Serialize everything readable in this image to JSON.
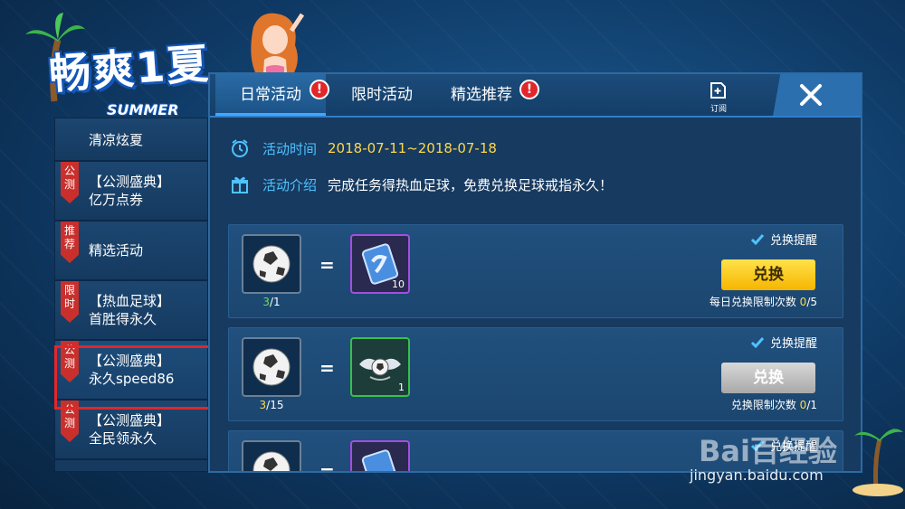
{
  "logo": {
    "title": "畅爽1夏",
    "subtitle": "SUMMER"
  },
  "sidebar": {
    "items": [
      {
        "tag": "",
        "line1": "清凉炫夏",
        "line2": ""
      },
      {
        "tag": "公测",
        "line1": "【公测盛典】",
        "line2": "亿万点券"
      },
      {
        "tag": "推荐",
        "line1": "精选活动",
        "line2": ""
      },
      {
        "tag": "限时",
        "line1": "【热血足球】",
        "line2": "首胜得永久"
      },
      {
        "tag": "公测",
        "line1": "【公测盛典】",
        "line2": "永久speed86"
      },
      {
        "tag": "公测",
        "line1": "【公测盛典】",
        "line2": "全民领永久"
      }
    ]
  },
  "tabs": [
    {
      "label": "日常活动",
      "badge": "!"
    },
    {
      "label": "限时活动",
      "badge": ""
    },
    {
      "label": "精选推荐",
      "badge": "!"
    }
  ],
  "header": {
    "subscribe_label": "订阅",
    "close_icon": "close-icon"
  },
  "info": {
    "time_key": "活动时间",
    "time_value": "2018-07-11~2018-07-18",
    "intro_key": "活动介绍",
    "intro_value": "完成任务得热血足球，免费兑换足球戒指永久！"
  },
  "cards": [
    {
      "have": "3",
      "need": "/1",
      "equals": "=",
      "reward_count": "10",
      "remind": "兑换提醒",
      "button": "兑换",
      "limit_label": "每日兑换限制次数",
      "limit_used": "0",
      "limit_total": "/5"
    },
    {
      "have": "3",
      "need": "/15",
      "equals": "=",
      "reward_count": "1",
      "remind": "兑换提醒",
      "button": "兑换",
      "limit_label": "兑换限制次数",
      "limit_used": "0",
      "limit_total": "/1"
    },
    {
      "equals": "=",
      "remind": "兑换提醒"
    }
  ],
  "watermark": {
    "brand": "Bai百经验",
    "url": "jingyan.baidu.com"
  },
  "colors": {
    "accent": "#3fa8ff",
    "gold": "#ffd84a",
    "badge": "#e3262a",
    "tag": "#c9302c"
  }
}
